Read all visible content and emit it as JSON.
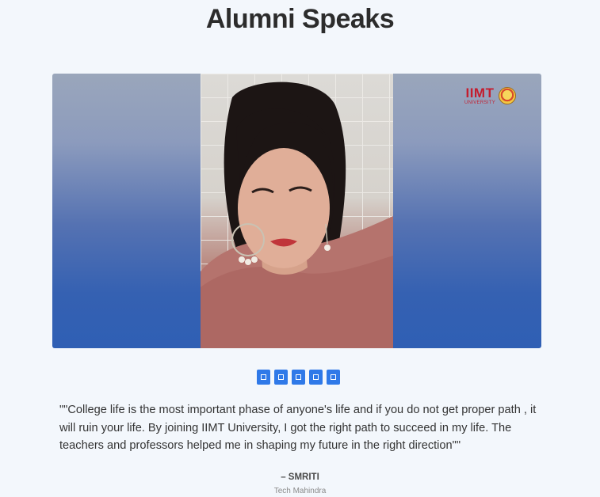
{
  "section": {
    "title": "Alumni Speaks"
  },
  "video": {
    "logo_main": "IIMT",
    "logo_sub": "UNIVERSITY"
  },
  "carousel": {
    "dot_count": 5,
    "active_index": 0,
    "accent_color": "#2f79e8"
  },
  "testimonial": {
    "quote": "\"\"College life is the most important phase of anyone's life and if you do not get proper path , it will ruin your life. By joining IIMT University, I got the right path to succeed in my life. The teachers and professors helped me in shaping my future in the right direction\"\"",
    "author": "– SMRITI",
    "company": "Tech Mahindra"
  }
}
